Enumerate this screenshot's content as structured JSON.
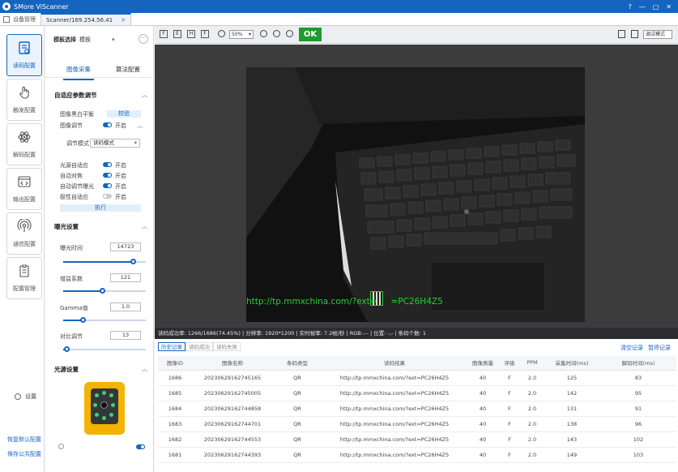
{
  "app": {
    "title": "SMore ViScanner",
    "window_buttons": [
      "?",
      "—",
      "▢",
      "✕"
    ]
  },
  "tabs": {
    "device_manage": "设备管理",
    "scanner": "Scanner/169.254.56.41",
    "scanner_close": "✕"
  },
  "nav": {
    "items": [
      {
        "label": "读码配置",
        "icon": "doc-icon"
      },
      {
        "label": "触发配置",
        "icon": "hand-icon"
      },
      {
        "label": "解码配置",
        "icon": "atom-icon"
      },
      {
        "label": "输出配置",
        "icon": "code-window-icon"
      },
      {
        "label": "通信配置",
        "icon": "broadcast-icon"
      },
      {
        "label": "配置管理",
        "icon": "clipboard-icon"
      }
    ],
    "settings_label": "设置",
    "restore_default": "恢复默认配置",
    "save_public": "保存公共配置"
  },
  "panel": {
    "mode_label": "模板选择",
    "mode_value": "模板",
    "more": "···",
    "tab_image": "图像采集",
    "tab_algo": "算法配置",
    "adaptive_title": "自适应参数调节",
    "img_capture_label": "图像黑白平衡",
    "img_capture_btn": "校验",
    "img_adjust_label": "图像调节",
    "img_adjust_state": "开启",
    "adjust_mode_label": "调节模式",
    "adjust_mode_value": "读码模式",
    "auto_light_label": "光源自适应",
    "auto_light_state": "开启",
    "auto_focus_label": "自动对焦",
    "auto_focus_state": "开启",
    "auto_exposure_label": "自动调节曝光",
    "auto_exposure_state": "开启",
    "polar_label": "极性自适应",
    "polar_state": "开启",
    "apply_btn": "执行",
    "exposure_title": "曝光设置",
    "exposure_time_label": "曝光时间",
    "exposure_time_value": "14723",
    "exposure_time_level": 0.84,
    "gain_label": "增益系数",
    "gain_value": "121",
    "gain_level": 0.47,
    "gamma_label": "Gamma值",
    "gamma_value": "1.0",
    "gamma_level": 0.24,
    "contrast_label": "对比调节",
    "contrast_value": "13",
    "contrast_level": 0.04,
    "light_title": "光源设置"
  },
  "toolbar": {
    "buttons": [
      "F",
      "E",
      "H",
      "F"
    ],
    "zoom": "50%",
    "zoom_caret": "▾",
    "ok_label": "OK",
    "view_mode": "调试模式"
  },
  "viewer": {
    "decoded_text": "http://tp.mmxchina.com/?ext=",
    "decoded_suffix": "=PC26H4Z5"
  },
  "statusbar": {
    "text": "读码成功率: 1266/1686(74.45%)  |  分辨率: 1920*1200  |  实时帧率: 7.2帧/秒  |  RGB:---  |  位置: -,-  |  条码个数: 1"
  },
  "results": {
    "tabs": [
      "历史记录",
      "读码成功",
      "读码失败"
    ],
    "clear_label": "清空记录",
    "pause_label": "暂停记录",
    "columns": [
      "图像ID",
      "图像名称",
      "条码类型",
      "读码结果",
      "图像质量",
      "评级",
      "PPM",
      "采集时间(ms)",
      "解码时间(ms)"
    ],
    "rows": [
      [
        "1686",
        "20230629162745165",
        "QR",
        "http://tp.mmxchina.com/?ext=PC26H4Z5",
        "40",
        "F",
        "2.0",
        "125",
        "83"
      ],
      [
        "1685",
        "20230629162745005",
        "QR",
        "http://tp.mmxchina.com/?ext=PC26H4Z5",
        "40",
        "F",
        "2.0",
        "142",
        "95"
      ],
      [
        "1684",
        "20230629162744858",
        "QR",
        "http://tp.mmxchina.com/?ext=PC26H4Z5",
        "40",
        "F",
        "2.0",
        "131",
        "91"
      ],
      [
        "1683",
        "20230629162744701",
        "QR",
        "http://tp.mmxchina.com/?ext=PC26H4Z5",
        "40",
        "F",
        "2.0",
        "138",
        "96"
      ],
      [
        "1682",
        "20230629162744553",
        "QR",
        "http://tp.mmxchina.com/?ext=PC26H4Z5",
        "40",
        "F",
        "2.0",
        "143",
        "102"
      ],
      [
        "1681",
        "20230629162744393",
        "QR",
        "http://tp.mmxchina.com/?ext=PC26H4Z5",
        "40",
        "F",
        "2.0",
        "149",
        "103"
      ]
    ]
  }
}
